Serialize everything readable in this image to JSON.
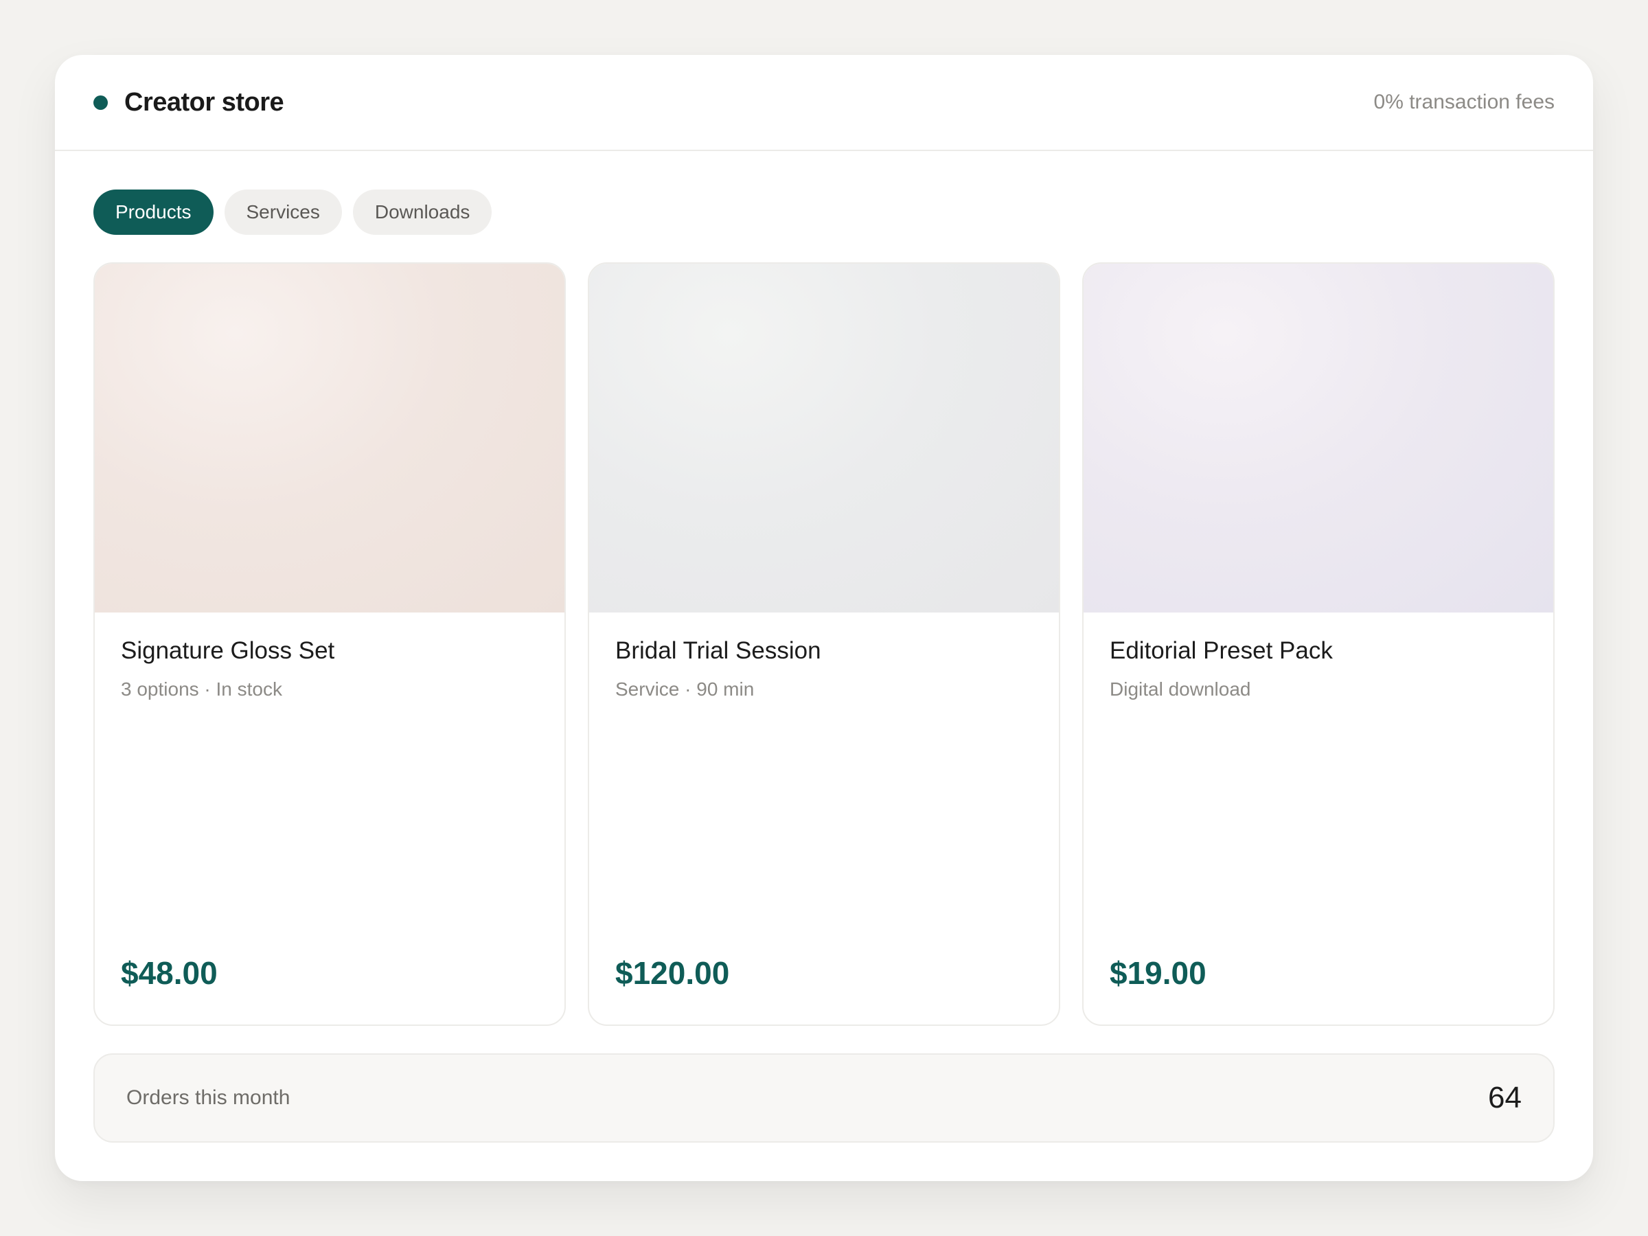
{
  "header": {
    "title": "Creator store",
    "fees": "0% transaction fees"
  },
  "tabs": [
    {
      "label": "Products",
      "active": true
    },
    {
      "label": "Services",
      "active": false
    },
    {
      "label": "Downloads",
      "active": false
    }
  ],
  "products": [
    {
      "name": "Signature Gloss Set",
      "meta": "3 options · In stock",
      "price": "$48.00"
    },
    {
      "name": "Bridal Trial Session",
      "meta": "Service · 90 min",
      "price": "$120.00"
    },
    {
      "name": "Editorial Preset Pack",
      "meta": "Digital download",
      "price": "$19.00"
    }
  ],
  "summary": {
    "label": "Orders this month",
    "value": "64"
  },
  "colors": {
    "accent": "#0f5c57",
    "background": "#f3f2ef"
  }
}
